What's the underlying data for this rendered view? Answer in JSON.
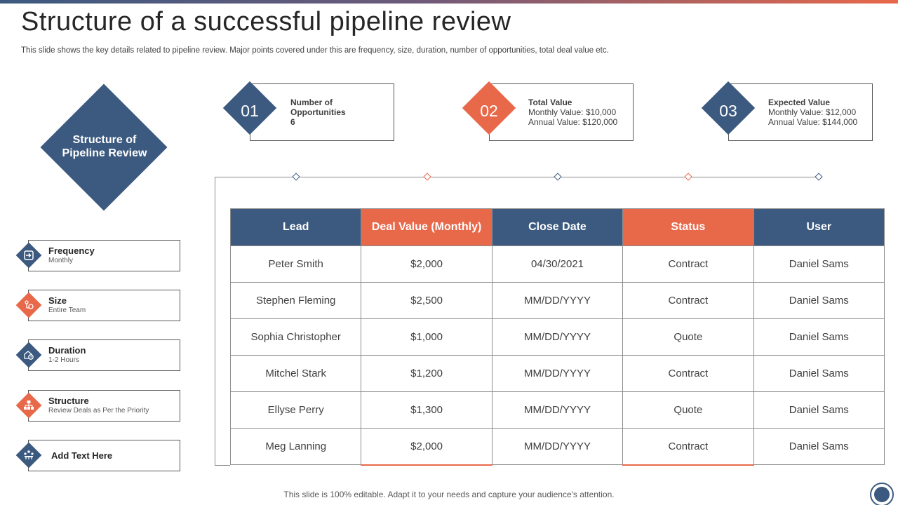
{
  "title": "Structure of a successful pipeline review",
  "subtitle": "This slide shows the key details related to pipeline review. Major points covered under this are frequency, size, duration, number of opportunities, total deal value etc.",
  "main_diamond": {
    "line1": "Structure of",
    "line2": "Pipeline Review"
  },
  "left_items": [
    {
      "title": "Frequency",
      "sub": "Monthly",
      "icon": "sign-in-icon"
    },
    {
      "title": "Size",
      "sub": "Entire Team",
      "icon": "team-size-icon"
    },
    {
      "title": "Duration",
      "sub": "1-2 Hours",
      "icon": "clock-icon"
    },
    {
      "title": "Structure",
      "sub": "Review Deals as Per the Priority",
      "icon": "hierarchy-icon"
    },
    {
      "title": "Add Text Here",
      "sub": "",
      "icon": "meeting-icon"
    }
  ],
  "cards": [
    {
      "num": "01",
      "line1": "Number of",
      "line2": "Opportunities",
      "line3": "6"
    },
    {
      "num": "02",
      "line1": "Total Value",
      "line2": "Monthly Value: $10,000",
      "line3": "Annual Value: $120,000"
    },
    {
      "num": "03",
      "line1": "Expected Value",
      "line2": "Monthly Value: $12,000",
      "line3": "Annual Value: $144,000"
    }
  ],
  "table": {
    "headers": [
      "Lead",
      "Deal Value (Monthly)",
      "Close Date",
      "Status",
      "User"
    ],
    "rows": [
      [
        "Peter Smith",
        "$2,000",
        "04/30/2021",
        "Contract",
        "Daniel Sams"
      ],
      [
        "Stephen Fleming",
        "$2,500",
        "MM/DD/YYYY",
        "Contract",
        "Daniel Sams"
      ],
      [
        "Sophia Christopher",
        "$1,000",
        "MM/DD/YYYY",
        "Quote",
        "Daniel Sams"
      ],
      [
        "Mitchel Stark",
        "$1,200",
        "MM/DD/YYYY",
        "Contract",
        "Daniel Sams"
      ],
      [
        "Ellyse Perry",
        "$1,300",
        "MM/DD/YYYY",
        "Quote",
        "Daniel Sams"
      ],
      [
        "Meg Lanning",
        "$2,000",
        "MM/DD/YYYY",
        "Contract",
        "Daniel Sams"
      ]
    ]
  },
  "footer": "This slide is 100% editable. Adapt it to your needs and capture your audience's attention.",
  "colors": {
    "blue": "#3c5a80",
    "orange": "#e8684a"
  }
}
